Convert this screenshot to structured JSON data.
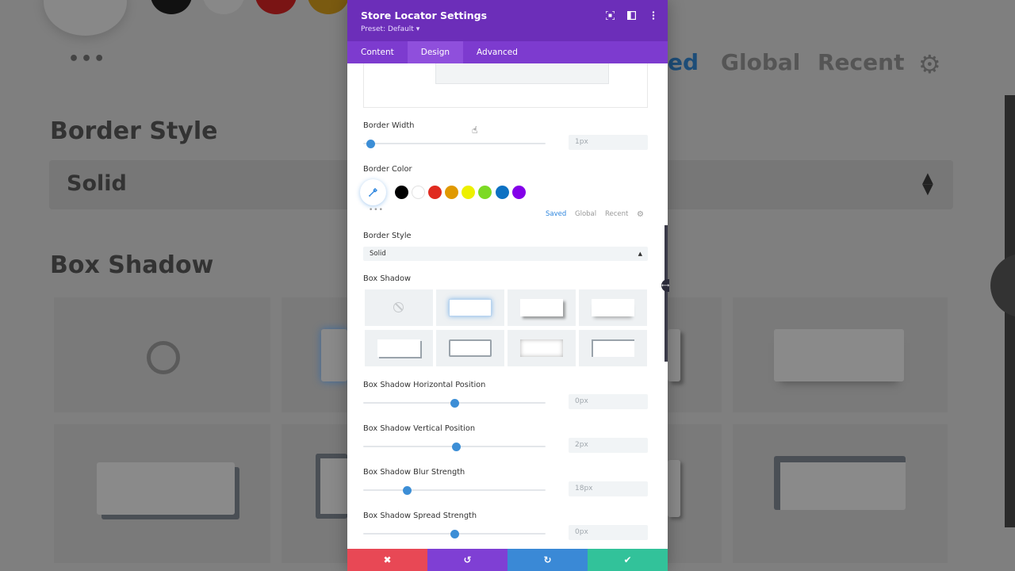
{
  "background": {
    "border_style_heading": "Border Style",
    "border_style_value": "Solid",
    "box_shadow_heading": "Box Shadow",
    "tab_saved_partial": "ed",
    "tab_global": "Global",
    "tab_recent": "Recent",
    "dots": "•••"
  },
  "panel": {
    "title": "Store Locator Settings",
    "preset": "Preset: Default ▾",
    "tabs": [
      {
        "label": "Content"
      },
      {
        "label": "Design"
      },
      {
        "label": "Advanced"
      }
    ],
    "active_tab": "Design"
  },
  "border_width": {
    "label": "Border Width",
    "value": "1px",
    "level": 0.04
  },
  "border_color": {
    "label": "Border Color",
    "swatches": [
      "#000000",
      "#ffffff",
      "#e02b20",
      "#e09900",
      "#edf000",
      "#7cda24",
      "#0c71c3",
      "#8300e9"
    ],
    "tabs": {
      "saved": "Saved",
      "global": "Global",
      "recent": "Recent"
    },
    "more": "•••"
  },
  "border_style": {
    "label": "Border Style",
    "value": "Solid"
  },
  "box_shadow": {
    "label": "Box Shadow",
    "selected_index": 1
  },
  "sliders": [
    {
      "label": "Box Shadow Horizontal Position",
      "value": "0px",
      "level": 0.5
    },
    {
      "label": "Box Shadow Vertical Position",
      "value": "2px",
      "level": 0.51
    },
    {
      "label": "Box Shadow Blur Strength",
      "value": "18px",
      "level": 0.24
    },
    {
      "label": "Box Shadow Spread Strength",
      "value": "0px",
      "level": 0.5
    }
  ],
  "footer": {
    "cancel": "✖",
    "undo": "↺",
    "redo": "↻",
    "save": "✔"
  },
  "colors": {
    "header": "#6c2eb9",
    "accent": "#2e86de"
  }
}
